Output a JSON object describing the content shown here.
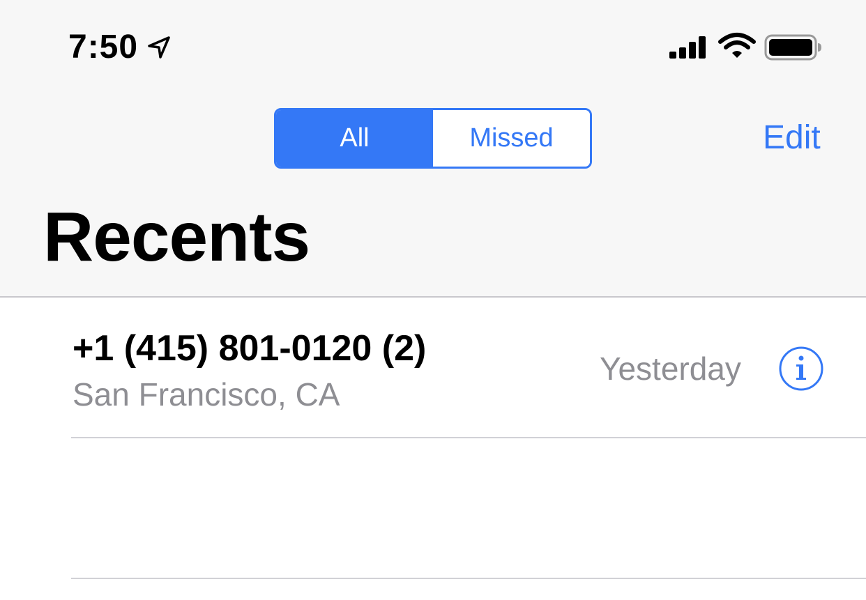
{
  "status_bar": {
    "time": "7:50",
    "icons": [
      "location-arrow-icon",
      "cellular-signal-icon",
      "wifi-icon",
      "battery-icon"
    ]
  },
  "segmented_control": {
    "options": [
      "All",
      "Missed"
    ],
    "selected": "All"
  },
  "nav": {
    "edit_label": "Edit"
  },
  "page": {
    "title": "Recents"
  },
  "recents": [
    {
      "number": "+1 (415) 801-0120 (2)",
      "location": "San Francisco, CA",
      "time": "Yesterday"
    }
  ],
  "colors": {
    "accent": "#3478f6",
    "header_bg": "#f7f7f7",
    "secondary_text": "#8e8e93",
    "separator": "#d1d1d6"
  }
}
